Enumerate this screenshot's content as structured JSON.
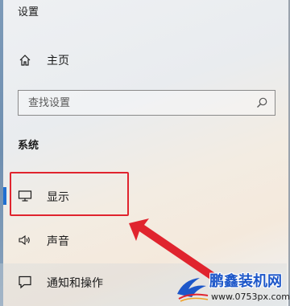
{
  "window": {
    "title": "设置"
  },
  "nav": {
    "home": {
      "label": "主页",
      "icon": "home-icon"
    },
    "search": {
      "placeholder": "查找设置",
      "icon": "search-icon"
    },
    "section_title": "系统",
    "items": [
      {
        "label": "显示",
        "icon": "monitor-icon",
        "selected": true
      },
      {
        "label": "声音",
        "icon": "speaker-icon",
        "selected": false
      },
      {
        "label": "通知和操作",
        "icon": "notification-icon",
        "selected": false
      }
    ]
  },
  "annotation": {
    "box_color": "#e0242e",
    "arrow_color": "#e0242e"
  },
  "watermark": {
    "title": "鹏鑫装机网",
    "url": "www.0753px.com"
  },
  "colors": {
    "accent": "#1f6fd1"
  }
}
